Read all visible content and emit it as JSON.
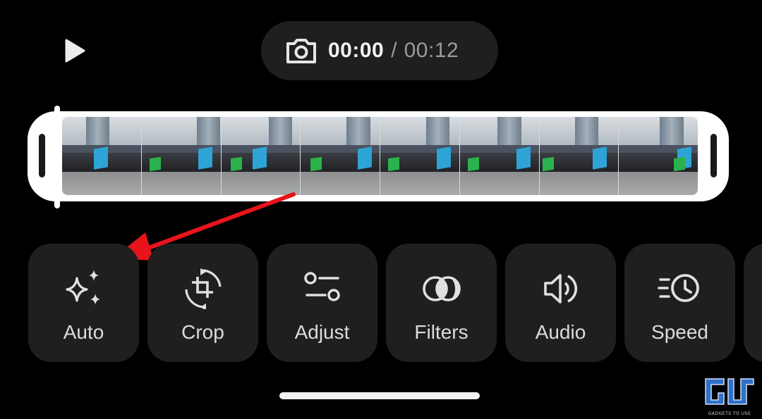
{
  "player": {
    "play_icon": "play-icon"
  },
  "time": {
    "current": "00:00",
    "separator": "/",
    "total": "00:12",
    "camera_icon": "camera-icon"
  },
  "timeline": {
    "frame_count": 8
  },
  "tools": [
    {
      "id": "auto",
      "label": "Auto",
      "icon": "sparkle-icon"
    },
    {
      "id": "crop",
      "label": "Crop",
      "icon": "crop-rotate-icon"
    },
    {
      "id": "adjust",
      "label": "Adjust",
      "icon": "adjust-sliders-icon"
    },
    {
      "id": "filters",
      "label": "Filters",
      "icon": "filters-icon"
    },
    {
      "id": "audio",
      "label": "Audio",
      "icon": "speaker-icon"
    },
    {
      "id": "speed",
      "label": "Speed",
      "icon": "speed-clock-icon"
    }
  ],
  "annotation": {
    "color": "#e8141b"
  },
  "watermark": {
    "logo": "GJ",
    "text": "GADGETS TO USE"
  }
}
